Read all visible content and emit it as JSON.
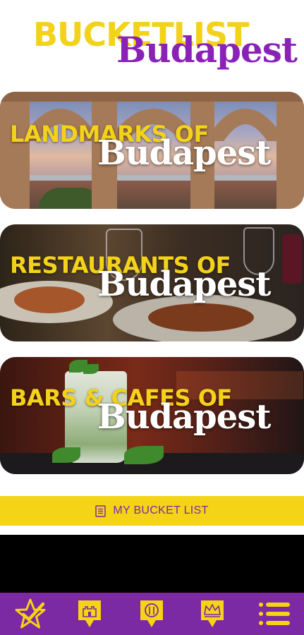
{
  "header": {
    "logo_top": "BUCKETLIST",
    "logo_bottom": "Budapest"
  },
  "cards": [
    {
      "line1": "LANDMARKS OF",
      "line2": "Budapest"
    },
    {
      "line1": "RESTAURANTS OF",
      "line2": "Budapest"
    },
    {
      "line1": "BARS & CAFES OF",
      "line2": "Budapest"
    }
  ],
  "bucket_list": {
    "label": "MY BUCKET LIST",
    "icon": "list-document-icon"
  },
  "bottom_nav": {
    "items": [
      {
        "icon": "star-check-icon"
      },
      {
        "icon": "castle-badge-icon"
      },
      {
        "icon": "restaurant-badge-icon"
      },
      {
        "icon": "crown-badge-icon"
      },
      {
        "icon": "menu-list-icon"
      }
    ]
  },
  "colors": {
    "yellow": "#f5d317",
    "purple": "#7b2aa3",
    "logo_purple": "#8a22b6"
  }
}
